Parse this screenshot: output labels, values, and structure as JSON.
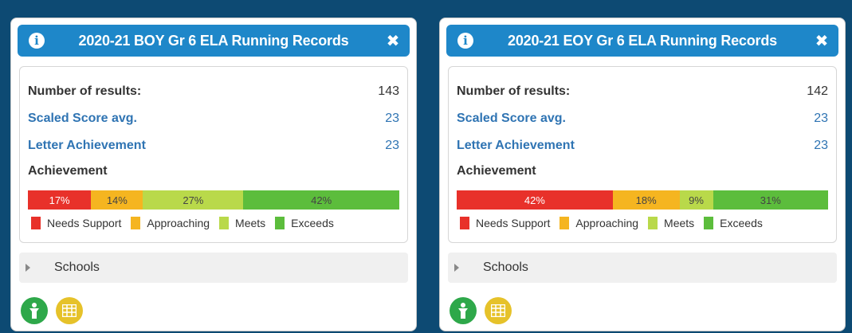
{
  "cards": [
    {
      "title": "2020-21 BOY Gr 6 ELA Running Records",
      "number_label": "Number of results:",
      "number_value": "143",
      "scaled_label": "Scaled Score avg.",
      "scaled_value": "23",
      "letter_label": "Letter Achievement",
      "letter_value": "23",
      "achievement_label": "Achievement",
      "segments": [
        {
          "label": "17%",
          "value": 17
        },
        {
          "label": "14%",
          "value": 14
        },
        {
          "label": "27%",
          "value": 27
        },
        {
          "label": "42%",
          "value": 42
        }
      ],
      "schools_label": "Schools"
    },
    {
      "title": "2020-21 EOY Gr 6 ELA Running Records",
      "number_label": "Number of results:",
      "number_value": "142",
      "scaled_label": "Scaled Score avg.",
      "scaled_value": "23",
      "letter_label": "Letter Achievement",
      "letter_value": "23",
      "achievement_label": "Achievement",
      "segments": [
        {
          "label": "42%",
          "value": 42
        },
        {
          "label": "18%",
          "value": 18
        },
        {
          "label": "9%",
          "value": 9
        },
        {
          "label": "31%",
          "value": 31
        }
      ],
      "schools_label": "Schools"
    }
  ],
  "legend": [
    "Needs Support",
    "Approaching",
    "Meets",
    "Exceeds"
  ],
  "colors": {
    "needs_support": "#e8312a",
    "approaching": "#f5b520",
    "meets": "#b9d94a",
    "exceeds": "#5cbd3c",
    "header": "#1e87c9",
    "link": "#2f74b3"
  },
  "icons": {
    "info": "info-icon",
    "close": "close-icon",
    "caret": "caret-right-icon",
    "person": "person-icon",
    "table": "table-icon"
  }
}
